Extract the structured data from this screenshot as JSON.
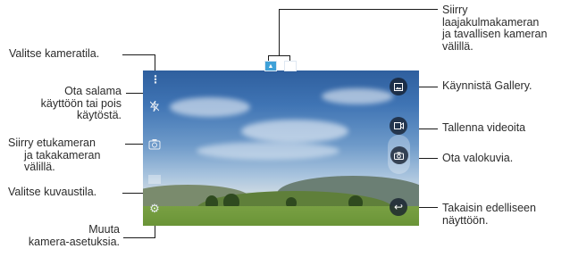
{
  "callouts": {
    "camera_mode": "Valitse kameratila.",
    "flash_1": "Ota salama",
    "flash_2": "käyttöön tai pois",
    "flash_3": "käytöstä.",
    "switch_cam_1": "Siirry etukameran",
    "switch_cam_2": "ja takakameran",
    "switch_cam_3": "välillä.",
    "shooting_mode": "Valitse kuvaustila.",
    "settings_1": "Muuta",
    "settings_2": "kamera-asetuksia.",
    "wide_1": "Siirry",
    "wide_2": "laajakulmakameran",
    "wide_3": "ja tavallisen kameran",
    "wide_4": "välillä.",
    "gallery": "Käynnistä Gallery.",
    "video": "Tallenna videoita",
    "photo": "Ota valokuvia.",
    "back_1": "Takaisin edelliseen",
    "back_2": "näyttöön."
  },
  "icons": {
    "menu": "more-vertical-icon",
    "flash": "flash-off-icon",
    "switch_camera": "switch-camera-icon",
    "shooting_mode": "shooting-mode-icon",
    "settings": "gear-icon",
    "gallery": "gallery-icon",
    "video": "video-icon",
    "camera": "camera-icon",
    "back": "back-icon",
    "lens_normal": "lens-standard-icon",
    "lens_wide": "lens-wide-icon"
  },
  "colors": {
    "accent_active_lens": "#3fa1d8"
  }
}
